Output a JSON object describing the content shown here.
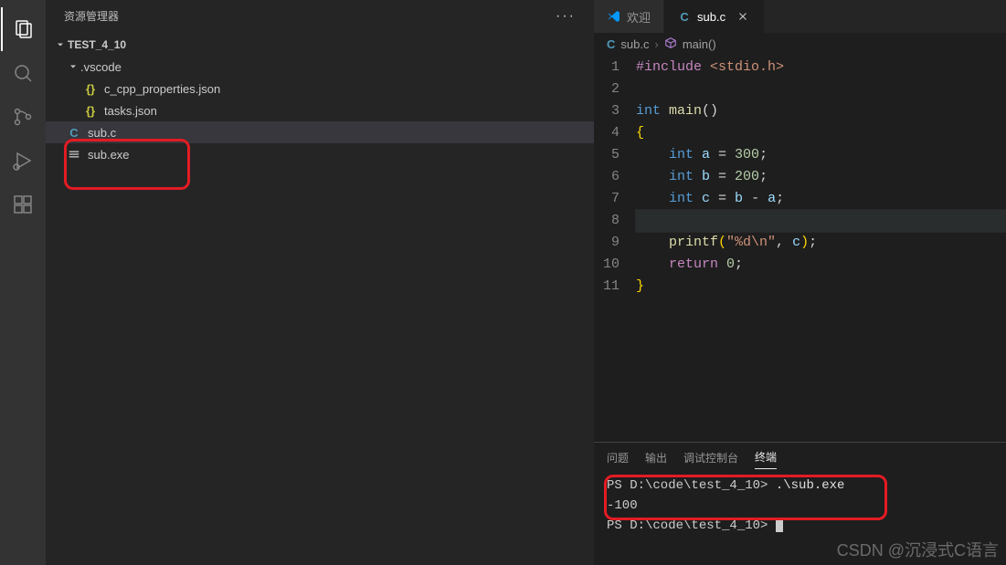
{
  "sidebar": {
    "title": "资源管理器",
    "root": "TEST_4_10",
    "folders": {
      "vscode": ".vscode"
    },
    "files": {
      "cpp_props": "c_cpp_properties.json",
      "tasks": "tasks.json",
      "sub_c": "sub.c",
      "sub_exe": "sub.exe"
    }
  },
  "tabs": {
    "welcome": "欢迎",
    "sub_c": "sub.c"
  },
  "breadcrumb": {
    "file": "sub.c",
    "symbol": "main()"
  },
  "code": {
    "lines": [
      "1",
      "2",
      "3",
      "4",
      "5",
      "6",
      "7",
      "8",
      "9",
      "10",
      "11"
    ],
    "l1_include": "#include",
    "l1_header": " <stdio.h>",
    "l3_type": "int",
    "l3_func": " main",
    "l3_paren": "()",
    "l4": "{",
    "l5_type": "    int",
    "l5_var": " a",
    "l5_rest": " = ",
    "l5_num": "300",
    "l5_semi": ";",
    "l6_type": "    int",
    "l6_var": " b",
    "l6_rest": " = ",
    "l6_num": "200",
    "l6_semi": ";",
    "l7_type": "    int",
    "l7_var": " c",
    "l7_rest": " = ",
    "l7_b": "b",
    "l7_op": " - ",
    "l7_a": "a",
    "l7_semi": ";",
    "l9_func": "    printf",
    "l9_paren1": "(",
    "l9_str": "\"%d\\n\"",
    "l9_comma": ", ",
    "l9_var": "c",
    "l9_paren2": ")",
    "l9_semi": ";",
    "l10_kw": "    return",
    "l10_num": " 0",
    "l10_semi": ";",
    "l11": "}"
  },
  "panel": {
    "tabs": {
      "problems": "问题",
      "output": "输出",
      "debug": "调试控制台",
      "terminal": "终端"
    },
    "terminal": {
      "prompt1": "PS D:\\code\\test_4_10> ",
      "cmd1": ".\\sub.exe",
      "out1": "-100",
      "prompt2": "PS D:\\code\\test_4_10> "
    }
  },
  "watermark": "CSDN @沉浸式C语言"
}
